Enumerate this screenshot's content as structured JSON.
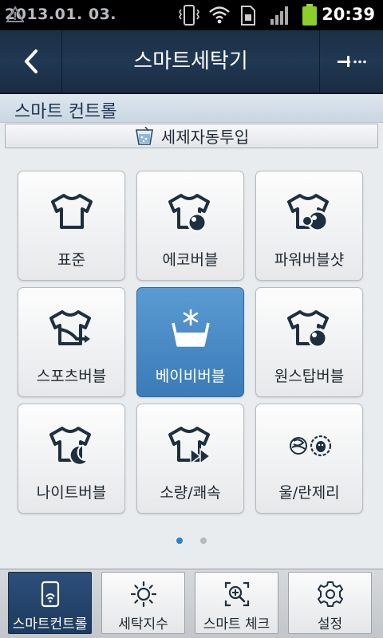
{
  "status_bar": {
    "date": "2013.01. 03.",
    "time": "20:39",
    "icons": [
      "warning-icon",
      "vibrate-icon",
      "wifi-icon",
      "sim-icon",
      "signal-icon",
      "battery-icon"
    ]
  },
  "header": {
    "title": "스마트세탁기",
    "back_icon": "chevron-left-icon",
    "menu_icon": "more-icon"
  },
  "section": {
    "title": "스마트 컨트롤",
    "auto_detergent_label": "세제자동투입"
  },
  "courses": [
    {
      "label": "표준",
      "icon": "shirt-icon",
      "selected": false
    },
    {
      "label": "에코버블",
      "icon": "shirt-bubble-icon",
      "selected": false
    },
    {
      "label": "파워버블샷",
      "icon": "shirt-power-bubble-icon",
      "selected": false
    },
    {
      "label": "스포츠버블",
      "icon": "shirt-sports-icon",
      "selected": false
    },
    {
      "label": "베이비버블",
      "icon": "baby-tub-icon",
      "selected": true
    },
    {
      "label": "원스탑버블",
      "icon": "shirt-onestop-icon",
      "selected": false
    },
    {
      "label": "나이트버블",
      "icon": "shirt-moon-icon",
      "selected": false
    },
    {
      "label": "소량/쾌속",
      "icon": "shirt-fast-forward-icon",
      "selected": false
    },
    {
      "label": "울/란제리",
      "icon": "wool-sheep-icon",
      "selected": false
    }
  ],
  "pagination": {
    "pages": 2,
    "current": 1
  },
  "bottom_nav": [
    {
      "label": "스마트컨트롤",
      "icon": "smart-control-icon",
      "active": true
    },
    {
      "label": "세탁지수",
      "icon": "sun-icon",
      "active": false
    },
    {
      "label": "스마트 체크",
      "icon": "smart-check-icon",
      "active": false
    },
    {
      "label": "설정",
      "icon": "gear-icon",
      "active": false
    }
  ],
  "colors": {
    "header_bg": "#203853",
    "accent": "#3a7bb8",
    "icon_dark": "#1e2f3f",
    "dot_active": "#2f7fd0"
  }
}
